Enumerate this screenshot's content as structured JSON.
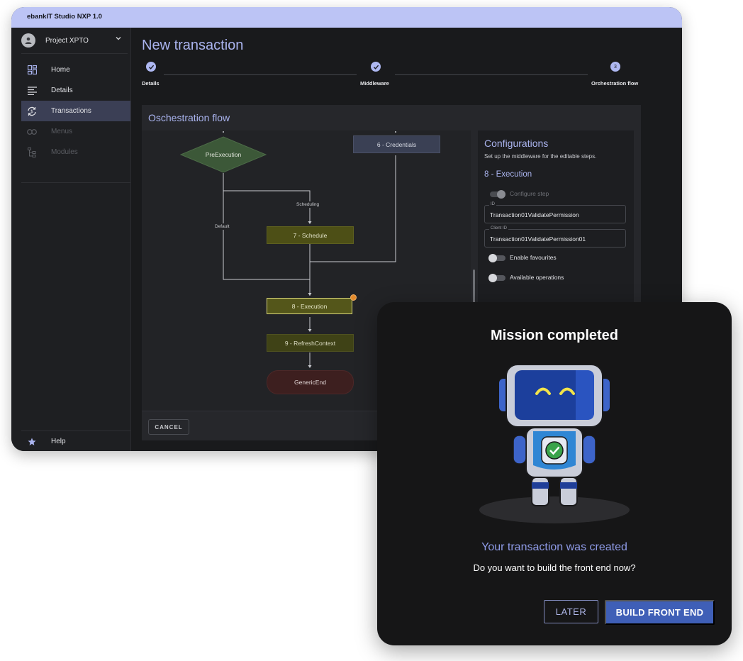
{
  "window": {
    "title": "ebankIT Studio NXP 1.0"
  },
  "sidebar": {
    "project": "Project XPTO",
    "items": [
      {
        "label": "Home",
        "icon": "dashboard-icon"
      },
      {
        "label": "Details",
        "icon": "list-icon"
      },
      {
        "label": "Transactions",
        "icon": "sync-icon",
        "active": true
      },
      {
        "label": "Menus",
        "icon": "link-icon",
        "disabled": true
      },
      {
        "label": "Modules",
        "icon": "tree-icon",
        "disabled": true
      }
    ],
    "help": "Help"
  },
  "page": {
    "title": "New transaction",
    "steps": [
      {
        "label": "Details",
        "state": "done"
      },
      {
        "label": "Middleware",
        "state": "done"
      },
      {
        "label": "Orchestration flow",
        "state": "current",
        "number": "3"
      }
    ]
  },
  "flow": {
    "title": "Oschestration flow",
    "nodes": {
      "pre": "PreExecution",
      "credentials": "6 - Credentials",
      "schedule": "7 - Schedule",
      "execution": "8 - Execution",
      "refresh": "9 - RefreshContext",
      "end": "GenericEnd"
    },
    "edges": {
      "scheduling": "Scheduling",
      "default": "Default"
    },
    "cancel": "CANCEL"
  },
  "config": {
    "title": "Configurations",
    "subtitle": "Set up the middleware for the editable steps.",
    "step": "8 - Execution",
    "configure_step": "Configure step",
    "id_label": "ID",
    "id_value": "Transaction01ValidatePermission",
    "client_id_label": "Client ID",
    "client_id_value": "Transaction01ValidatePermission01",
    "enable_favourites": "Enable favourites",
    "available_operations": "Available operations"
  },
  "modal": {
    "title": "Mission completed",
    "subtitle": "Your transaction was created",
    "question": "Do you want to build the front end now?",
    "later": "LATER",
    "build": "BUILD FRONT END"
  },
  "colors": {
    "accent": "#aab4ef",
    "primary_button": "#3f5fb7",
    "titlebar": "#bcc4f5"
  }
}
